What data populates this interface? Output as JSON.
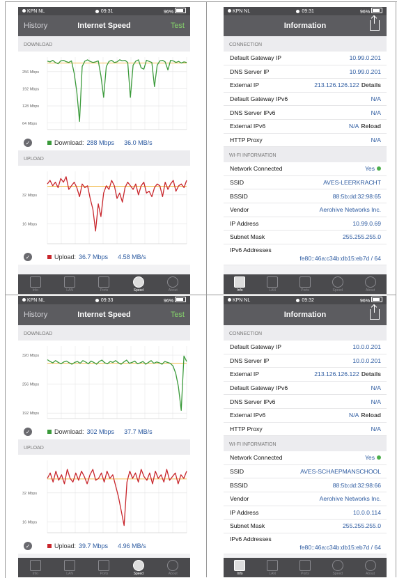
{
  "status_bar": {
    "carrier": "KPN NL",
    "battery": "96%"
  },
  "speed_screens": [
    {
      "time": "09:31",
      "nav_left": "History",
      "title": "Internet Speed",
      "nav_right": "Test",
      "download": {
        "section": "DOWNLOAD",
        "label": "Download:",
        "mbps": "288 Mbps",
        "mbs": "36.0 MB/s",
        "color": "#3a9a3a",
        "chart_data": {
          "type": "line",
          "yticks": [
            "256 Mbps",
            "192 Mbps",
            "128 Mbps",
            "64 Mbps"
          ],
          "ytick_values": [
            256,
            192,
            128,
            64
          ],
          "ylim": [
            40,
            310
          ],
          "avg": 288,
          "values": [
            295,
            292,
            298,
            290,
            285,
            296,
            298,
            293,
            290,
            296,
            250,
            180,
            70,
            275,
            295,
            300,
            294,
            290,
            292,
            296,
            240,
            160,
            275,
            294,
            298,
            290,
            292,
            300,
            296,
            298,
            290,
            160,
            280,
            295,
            300,
            270,
            265,
            298,
            294,
            290,
            200,
            280,
            296,
            298,
            292,
            262,
            298,
            296,
            290,
            294,
            288,
            292,
            290
          ]
        }
      },
      "upload": {
        "section": "UPLOAD",
        "label": "Upload:",
        "mbps": "36.7 Mbps",
        "mbs": "4.58 MB/s",
        "color": "#c8262c",
        "chart_data": {
          "type": "line",
          "yticks": [
            "32 Mbps",
            "16 Mbps"
          ],
          "ytick_values": [
            32,
            16
          ],
          "ylim": [
            5,
            45
          ],
          "avg": 36.7,
          "values": [
            38,
            40,
            37,
            39,
            36,
            41,
            39,
            42,
            35,
            37,
            39,
            36,
            31,
            38,
            36,
            37,
            30,
            24,
            12,
            27,
            20,
            33,
            37,
            35,
            40,
            37,
            30,
            33,
            28,
            36,
            39,
            37,
            35,
            38,
            32,
            37,
            39,
            33,
            34,
            31,
            36,
            38,
            37,
            31,
            39,
            35,
            38,
            40,
            34,
            37,
            38,
            36,
            40
          ]
        }
      }
    },
    {
      "time": "09:33",
      "nav_left": "History",
      "title": "Internet Speed",
      "nav_right": "Test",
      "download": {
        "section": "DOWNLOAD",
        "label": "Download:",
        "mbps": "302 Mbps",
        "mbs": "37.7 MB/s",
        "color": "#3a9a3a",
        "chart_data": {
          "type": "line",
          "yticks": [
            "320 Mbps",
            "256 Mbps",
            "192 Mbps"
          ],
          "ytick_values": [
            320,
            256,
            192
          ],
          "ylim": [
            180,
            340
          ],
          "avg": 302,
          "values": [
            310,
            306,
            303,
            308,
            304,
            301,
            305,
            307,
            303,
            300,
            304,
            306,
            302,
            308,
            305,
            301,
            307,
            304,
            300,
            306,
            309,
            303,
            301,
            306,
            304,
            308,
            303,
            300,
            305,
            309,
            302,
            304,
            307,
            301,
            303,
            306,
            300,
            304,
            308,
            302,
            305,
            303,
            300,
            306,
            304,
            302,
            296,
            280,
            250,
            198,
            318,
            306
          ]
        }
      },
      "upload": {
        "section": "UPLOAD",
        "label": "Upload:",
        "mbps": "39.7 Mbps",
        "mbs": "4.96 MB/s",
        "color": "#c8262c",
        "chart_data": {
          "type": "line",
          "yticks": [
            "32 Mbps",
            "16 Mbps"
          ],
          "ytick_values": [
            32,
            16
          ],
          "ylim": [
            10,
            50
          ],
          "avg": 39.7,
          "values": [
            40,
            43,
            38,
            44,
            39,
            42,
            37,
            45,
            40,
            38,
            43,
            39,
            44,
            41,
            37,
            42,
            45,
            39,
            40,
            43,
            38,
            44,
            40,
            42,
            36,
            30,
            22,
            14,
            38,
            44,
            40,
            43,
            38,
            45,
            41,
            39,
            43,
            37,
            44,
            40,
            42,
            38,
            45,
            39,
            41,
            43,
            37,
            42,
            40,
            44
          ]
        }
      }
    }
  ],
  "info_screens": [
    {
      "time": "09:31",
      "title": "Information",
      "connection_header": "CONNECTION",
      "connection": [
        {
          "label": "Default Gateway IP",
          "value": "10.99.0.201",
          "extra": ""
        },
        {
          "label": "DNS Server IP",
          "value": "10.99.0.201",
          "extra": ""
        },
        {
          "label": "External IP",
          "value": "213.126.126.122",
          "extra": "Details"
        },
        {
          "label": "Default Gateway IPv6",
          "value": "N/A",
          "extra": ""
        },
        {
          "label": "DNS Server IPv6",
          "value": "N/A",
          "extra": ""
        },
        {
          "label": "External IPv6",
          "value": "N/A",
          "extra": "Reload"
        },
        {
          "label": "HTTP Proxy",
          "value": "N/A",
          "extra": ""
        }
      ],
      "wifi_header": "WI-FI INFORMATION",
      "wifi": [
        {
          "label": "Network Connected",
          "value": "Yes",
          "extra": ""
        },
        {
          "label": "SSID",
          "value": "AVES-LEERKRACHT",
          "extra": ""
        },
        {
          "label": "BSSID",
          "value": "88:5b:dd:32:98:65",
          "extra": ""
        },
        {
          "label": "Vendor",
          "value": "Aerohive Networks Inc.",
          "extra": ""
        },
        {
          "label": "IP Address",
          "value": "10.99.0.69",
          "extra": ""
        },
        {
          "label": "Subnet Mask",
          "value": "255.255.255.0",
          "extra": ""
        },
        {
          "label": "IPv6 Addresses",
          "value": "fe80::46a:c34b:db15:eb7d / 64",
          "extra": ""
        }
      ]
    },
    {
      "time": "09:32",
      "title": "Information",
      "connection_header": "CONNECTION",
      "connection": [
        {
          "label": "Default Gateway IP",
          "value": "10.0.0.201",
          "extra": ""
        },
        {
          "label": "DNS Server IP",
          "value": "10.0.0.201",
          "extra": ""
        },
        {
          "label": "External IP",
          "value": "213.126.126.122",
          "extra": "Details"
        },
        {
          "label": "Default Gateway IPv6",
          "value": "N/A",
          "extra": ""
        },
        {
          "label": "DNS Server IPv6",
          "value": "N/A",
          "extra": ""
        },
        {
          "label": "External IPv6",
          "value": "N/A",
          "extra": "Reload"
        },
        {
          "label": "HTTP Proxy",
          "value": "N/A",
          "extra": ""
        }
      ],
      "wifi_header": "WI-FI INFORMATION",
      "wifi": [
        {
          "label": "Network Connected",
          "value": "Yes",
          "extra": ""
        },
        {
          "label": "SSID",
          "value": "AVES-SCHAEPMANSCHOOL",
          "extra": ""
        },
        {
          "label": "BSSID",
          "value": "88:5b:dd:32:98:66",
          "extra": ""
        },
        {
          "label": "Vendor",
          "value": "Aerohive Networks Inc.",
          "extra": ""
        },
        {
          "label": "IP Address",
          "value": "10.0.0.114",
          "extra": ""
        },
        {
          "label": "Subnet Mask",
          "value": "255.255.255.0",
          "extra": ""
        },
        {
          "label": "IPv6 Addresses",
          "value": "fe80::46a:c34b:db15:eb7d / 64",
          "extra": ""
        }
      ]
    }
  ],
  "tabs": [
    {
      "label": "Info",
      "icon": "clipboard-icon"
    },
    {
      "label": "LAN",
      "icon": "network-icon"
    },
    {
      "label": "Ports",
      "icon": "toolbox-icon"
    },
    {
      "label": "Speed",
      "icon": "speedometer-icon"
    },
    {
      "label": "About",
      "icon": "info-icon"
    }
  ]
}
